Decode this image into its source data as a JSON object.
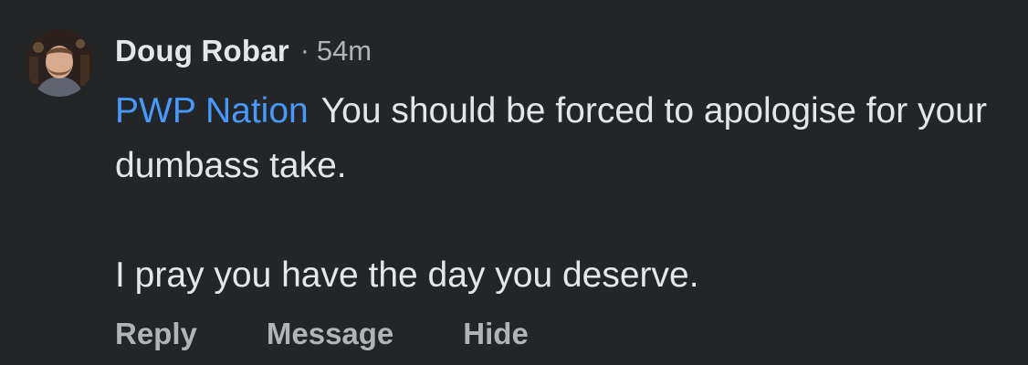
{
  "comment": {
    "author": "Doug Robar",
    "separator": "·",
    "time": "54m",
    "mention": "PWP Nation",
    "line1": "You should be forced to apologise for your dumbass take.",
    "line2": "I pray you have the day you deserve.",
    "actions": {
      "reply": "Reply",
      "message": "Message",
      "hide": "Hide"
    }
  },
  "colors": {
    "background": "#242526",
    "text": "#e4e6eb",
    "secondary": "#b0b3b8",
    "mention": "#4599ff"
  },
  "icons": {
    "avatar": "user-avatar-photo"
  }
}
